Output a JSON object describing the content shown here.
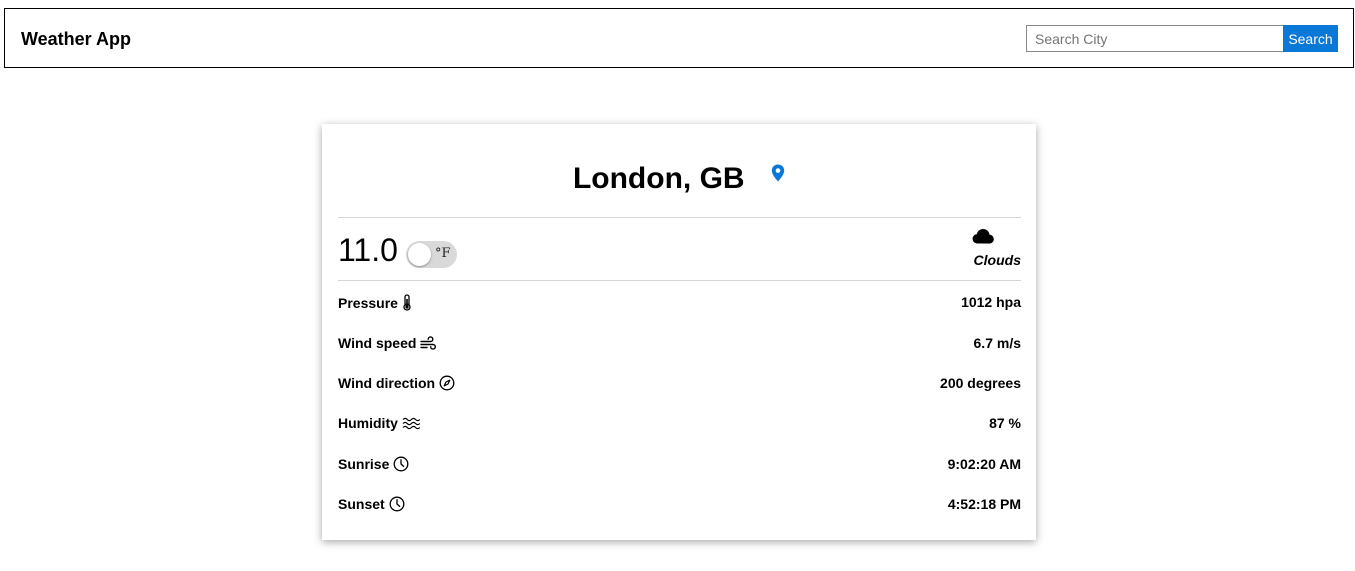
{
  "navbar": {
    "brand": "Weather App",
    "search": {
      "placeholder": "Search City",
      "value": "",
      "button_label": "Search"
    }
  },
  "card": {
    "city": "London, GB",
    "temperature": "11.0",
    "unit_label": "°F",
    "unit_toggle_on": false,
    "weather": {
      "label": "Clouds",
      "icon": "cloud-icon"
    },
    "details": [
      {
        "label": "Pressure",
        "icon": "thermometer-icon",
        "value": "1012 hpa"
      },
      {
        "label": "Wind speed",
        "icon": "wind-icon",
        "value": "6.7 m/s"
      },
      {
        "label": "Wind direction",
        "icon": "compass-icon",
        "value": "200 degrees"
      },
      {
        "label": "Humidity",
        "icon": "water-icon",
        "value": "87 %"
      },
      {
        "label": "Sunrise",
        "icon": "clock-icon",
        "value": "9:02:20 AM"
      },
      {
        "label": "Sunset",
        "icon": "clock-icon",
        "value": "4:52:18 PM"
      }
    ]
  },
  "colors": {
    "accent": "#0a78d7",
    "divider": "#d5d5d5",
    "toggle_track": "#d9d9d9"
  }
}
